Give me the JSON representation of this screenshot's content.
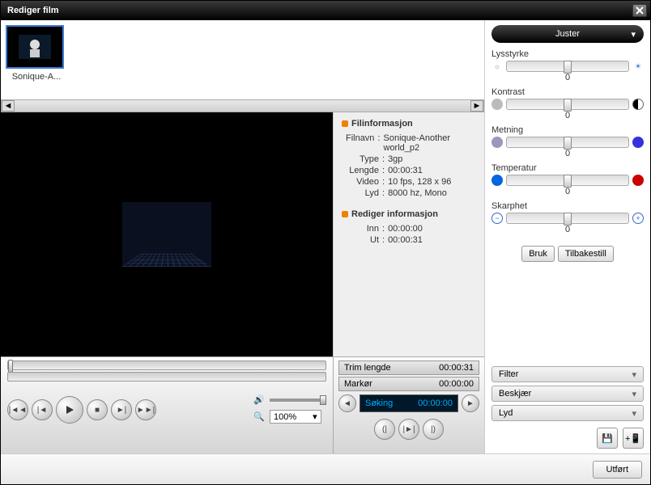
{
  "window": {
    "title": "Rediger film"
  },
  "thumb": {
    "label": "Sonique-A..."
  },
  "fileinfo": {
    "heading": "Filinformasjon",
    "filename_label": "Filnavn",
    "filename": "Sonique-Another world_p2",
    "type_label": "Type",
    "type": "3gp",
    "length_label": "Lengde",
    "length": "00:00:31",
    "video_label": "Video",
    "video": "10 fps, 128 x 96",
    "audio_label": "Lyd",
    "audio": "8000 hz, Mono"
  },
  "editinfo": {
    "heading": "Rediger informasjon",
    "in_label": "Inn",
    "in": "00:00:00",
    "out_label": "Ut",
    "out": "00:00:31"
  },
  "trim": {
    "length_label": "Trim lengde",
    "length": "00:00:31",
    "marker_label": "Markør",
    "marker": "00:00:00"
  },
  "seek": {
    "label": "Søking",
    "time": "00:00:00"
  },
  "zoom": {
    "value": "100%"
  },
  "adjust": {
    "dropdown": "Juster",
    "brightness": {
      "label": "Lysstyrke",
      "value": "0"
    },
    "contrast": {
      "label": "Kontrast",
      "value": "0"
    },
    "saturation": {
      "label": "Metning",
      "value": "0"
    },
    "temperature": {
      "label": "Temperatur",
      "value": "0"
    },
    "sharpness": {
      "label": "Skarphet",
      "value": "0"
    },
    "apply": "Bruk",
    "reset": "Tilbakestill"
  },
  "panels": {
    "filter": "Filter",
    "crop": "Beskjær",
    "audio": "Lyd"
  },
  "footer": {
    "done": "Utført"
  }
}
